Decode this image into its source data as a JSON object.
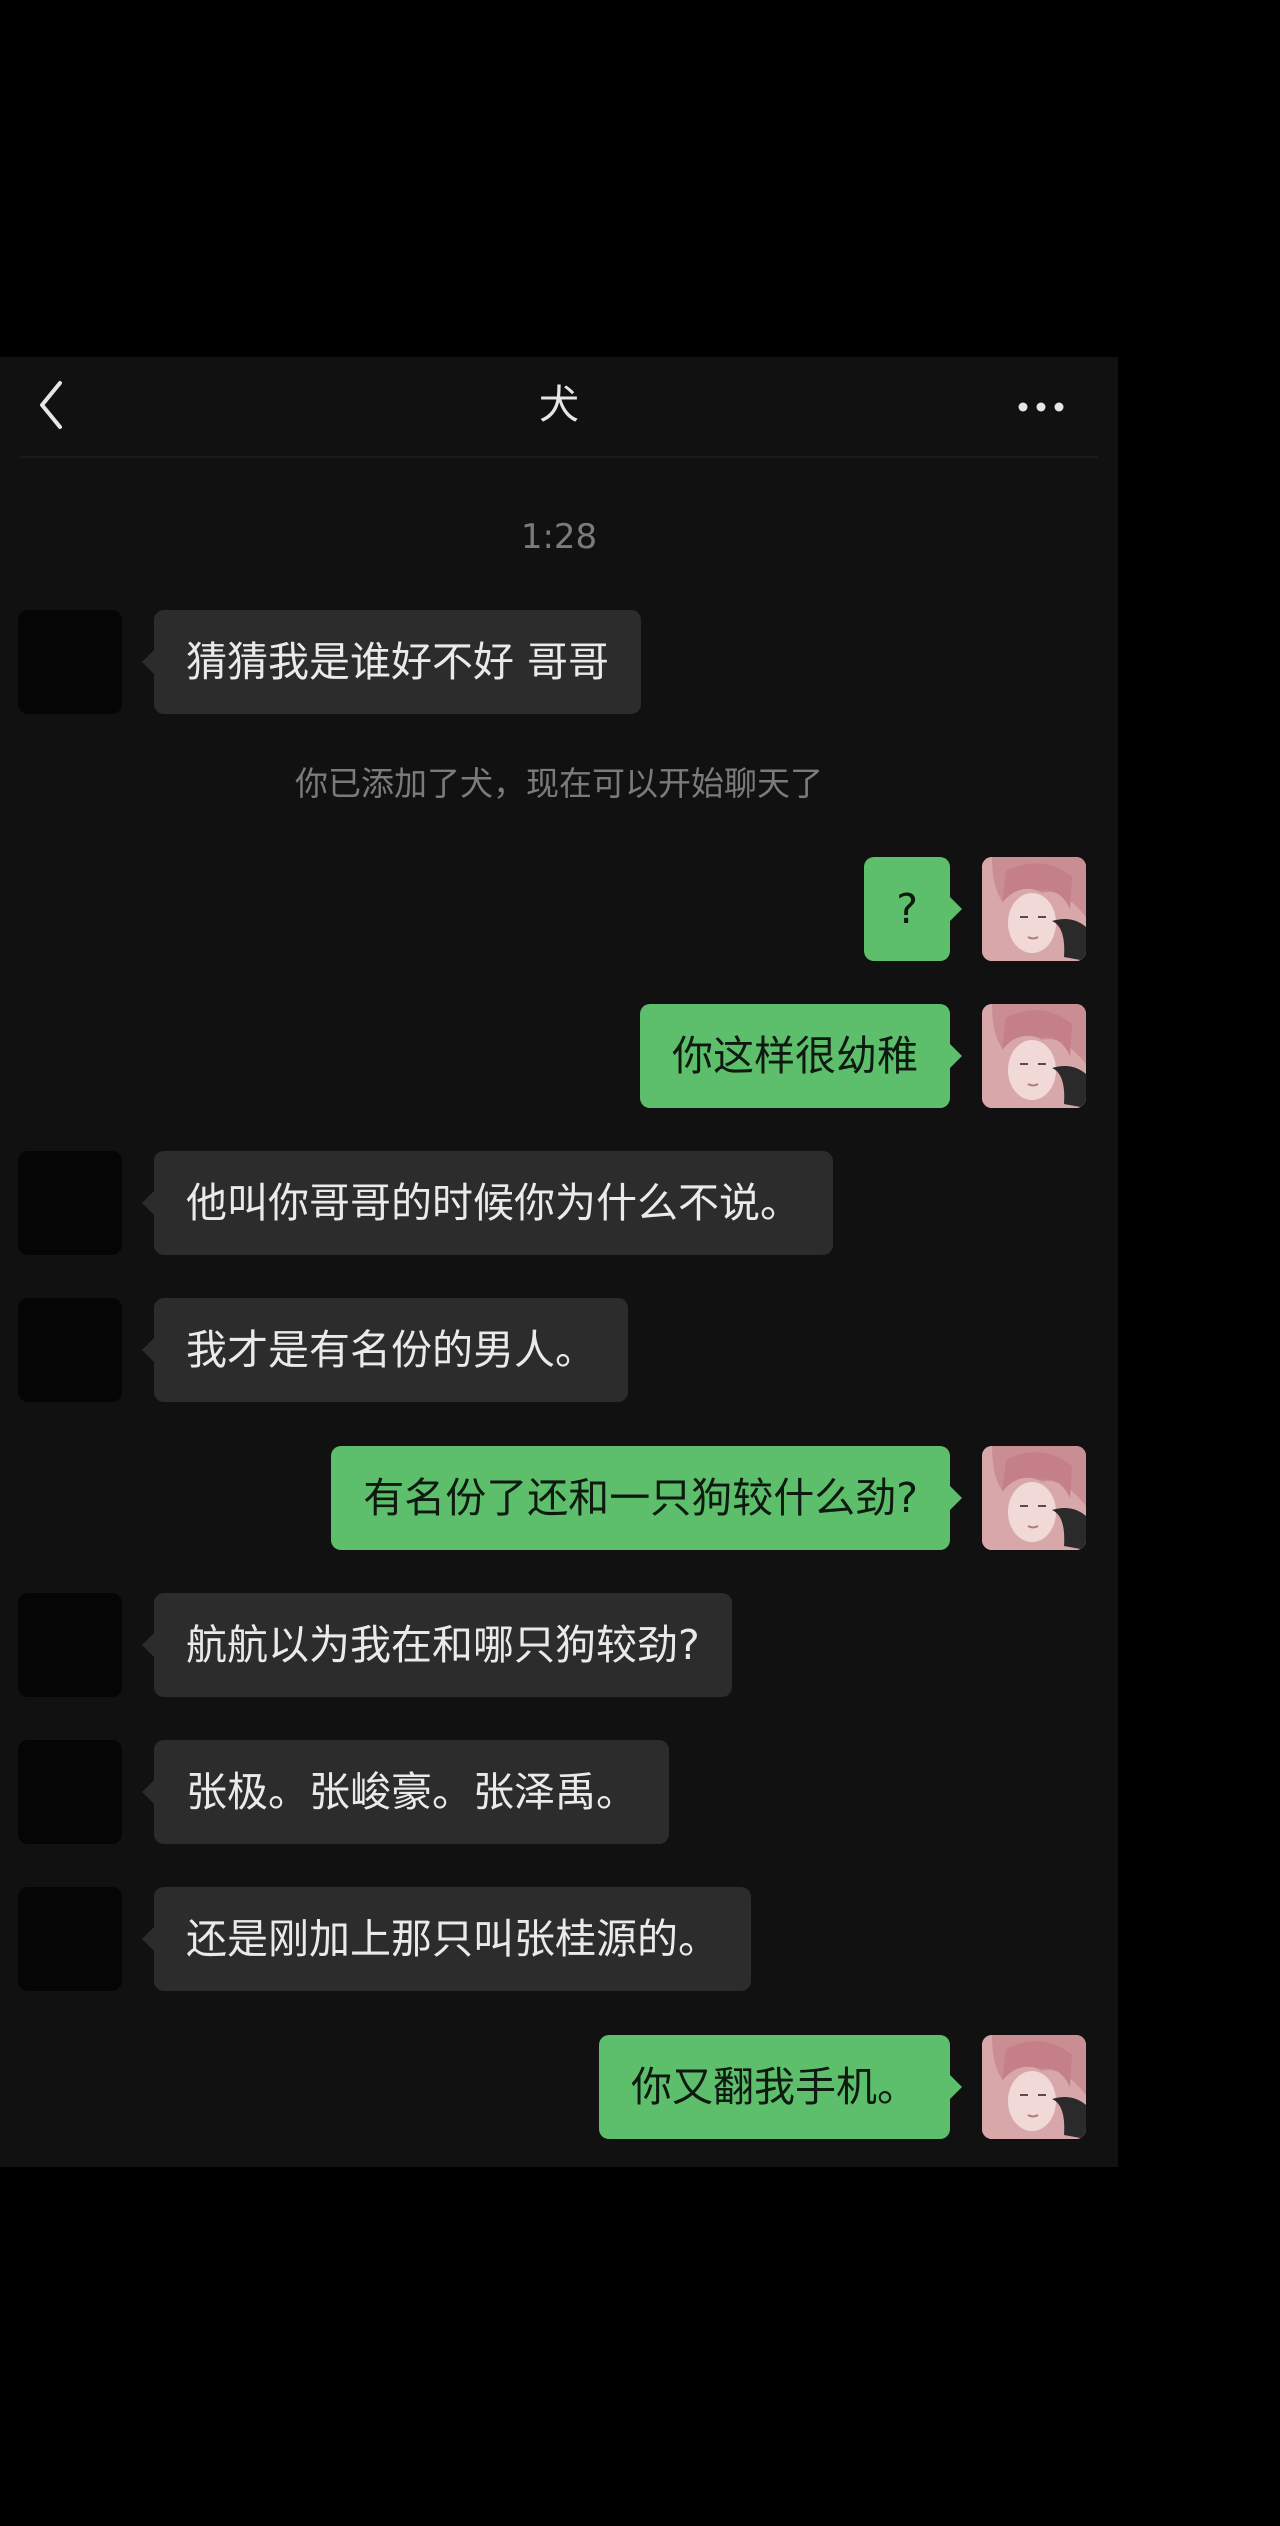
{
  "header": {
    "title": "犬",
    "back_icon": "chevron-left-icon",
    "more_icon": "more-dots-icon"
  },
  "timestamp": "1:28",
  "system_note": "你已添加了犬，现在可以开始聊天了",
  "colors": {
    "background": "#111111",
    "incoming_bubble": "#2c2c2c",
    "outgoing_bubble": "#5dbf6c"
  },
  "messages": [
    {
      "side": "left",
      "text": "猜猜我是谁好不好 哥哥"
    },
    {
      "side": "right",
      "text": "?"
    },
    {
      "side": "right",
      "text": "你这样很幼稚"
    },
    {
      "side": "left",
      "text": "他叫你哥哥的时候你为什么不说。"
    },
    {
      "side": "left",
      "text": "我才是有名份的男人。"
    },
    {
      "side": "right",
      "text": "有名份了还和一只狗较什么劲?"
    },
    {
      "side": "left",
      "text": "航航以为我在和哪只狗较劲?"
    },
    {
      "side": "left",
      "text": "张极。张峻豪。张泽禹。"
    },
    {
      "side": "left",
      "text": "还是刚加上那只叫张桂源的。"
    },
    {
      "side": "right",
      "text": "你又翻我手机。"
    }
  ]
}
